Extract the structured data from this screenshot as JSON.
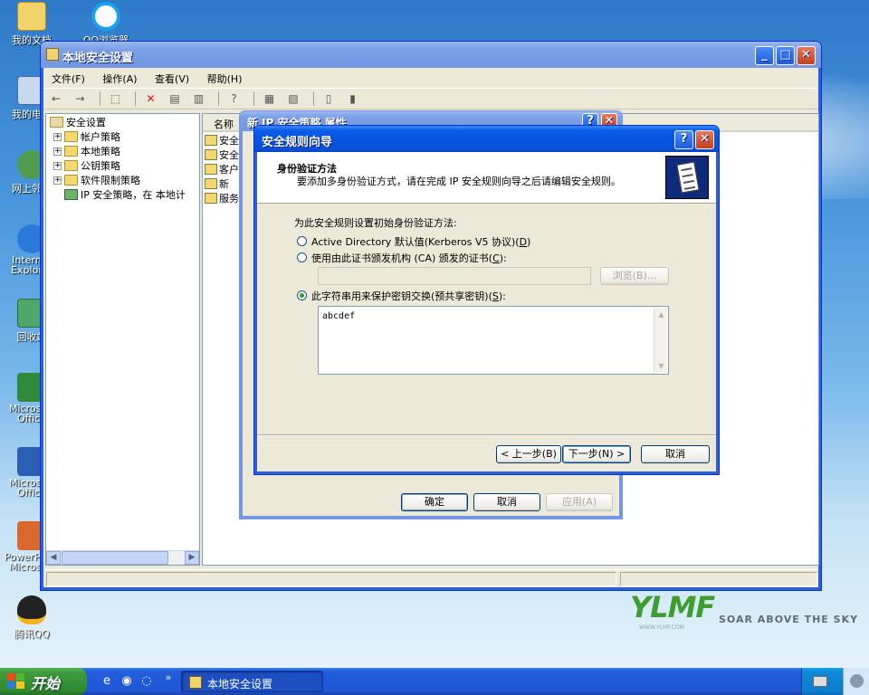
{
  "desktop": {
    "icons": [
      {
        "label": "我的文档"
      },
      {
        "label": "QQ浏览器"
      },
      {
        "label": "我的电脑"
      },
      {
        "label": "网上邻居"
      },
      {
        "label": "Internet Explorer"
      },
      {
        "label": "回收站"
      },
      {
        "label": "Microsoft Office"
      },
      {
        "label": "Microsoft Office"
      },
      {
        "label": "PowerPoint Microsoft"
      },
      {
        "label": "腾讯QQ"
      }
    ],
    "brand": {
      "logo": "YLMF",
      "slogan": "SOAR ABOVE THE SKY",
      "url": "WWW.YLMF.COM"
    }
  },
  "main_window": {
    "title": "本地安全设置",
    "menu": [
      "文件(F)",
      "操作(A)",
      "查看(V)",
      "帮助(H)"
    ],
    "toolbar_icons": [
      "back-icon",
      "forward-icon",
      "up-folder-icon",
      "delete-icon",
      "properties-icon",
      "refresh-icon",
      "help-icon",
      "export-icon",
      "import-icon",
      "assign-icon",
      "unassign-icon"
    ],
    "tree": {
      "root": "安全设置",
      "items": [
        "帐户策略",
        "本地策略",
        "公钥策略",
        "软件限制策略",
        "IP 安全策略，在 本地计"
      ]
    },
    "list": {
      "column": "名称",
      "rows": [
        "安全",
        "安全",
        "客户",
        "新",
        "服务"
      ]
    }
  },
  "property_dialog": {
    "title": "新 IP 安全策略 属性",
    "buttons": {
      "ok": "确定",
      "cancel": "取消",
      "apply": "应用(A)"
    }
  },
  "wizard": {
    "title": "安全规则向导",
    "heading": "身份验证方法",
    "subheading": "要添加多身份验证方式，请在完成 IP 安全规则向导之后请编辑安全规则。",
    "prompt": "为此安全规则设置初始身份验证方法:",
    "options": [
      {
        "label": "Active Directory 默认值(Kerberos V5 协议)",
        "key": "D",
        "selected": false
      },
      {
        "label": "使用由此证书颁发机构 (CA) 颁发的证书",
        "key": "C",
        "selected": false
      },
      {
        "label": "此字符串用来保护密钥交换(预共享密钥)",
        "key": "S",
        "selected": true
      }
    ],
    "browse_label": "浏览(B)...",
    "preshared_key": "abcdef",
    "buttons": {
      "back": "< 上一步(B)",
      "next": "下一步(N) >",
      "cancel": "取消"
    }
  },
  "taskbar": {
    "start_label": "开始",
    "task_label": "本地安全设置",
    "overflow": "»"
  }
}
